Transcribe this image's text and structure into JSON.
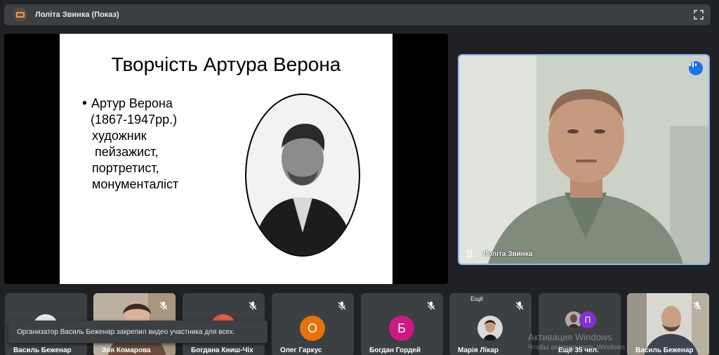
{
  "window": {
    "title": "Лоліта Звинка (Показ)"
  },
  "slide": {
    "title": "Творчість Артура Верона",
    "bullet": "Артур Верона",
    "dates": "(1867-1947рр.)",
    "lines": [
      "художник",
      "пейзажист,",
      "портретист,",
      "монументаліст"
    ]
  },
  "speaker": {
    "name": "Лоліта Звинка"
  },
  "tiles": [
    {
      "name": "Василь Беженар"
    },
    {
      "name": "Зоя Комарова"
    },
    {
      "name": "Богдана Книш-Чіх"
    },
    {
      "name": "Олег Гаркус",
      "initial": "О",
      "color": "#e8710a"
    },
    {
      "name": "Богдан Гордей",
      "initial": "Б",
      "color": "#d01884"
    },
    {
      "name": "Марія Лікар",
      "overflow": "Ещё"
    },
    {
      "name": "Ещё 35 чел.",
      "initial": "П",
      "color": "#8430ce"
    },
    {
      "name": "Василь Беженар"
    }
  ],
  "toast": {
    "text": "Организатор Василь Беженар закрепил видео участника для всех."
  },
  "watermark": {
    "line1": "Активация Windows",
    "line2": "Чтобы активировать Windows"
  },
  "colors": {
    "accent": "#8ab4f8",
    "tile_bg": "#3c4043",
    "page_bg": "#202124"
  },
  "icons": [
    "presentation-icon",
    "expand-icon",
    "audio-indicator-icon",
    "pin-icon",
    "mic-off-icon"
  ]
}
